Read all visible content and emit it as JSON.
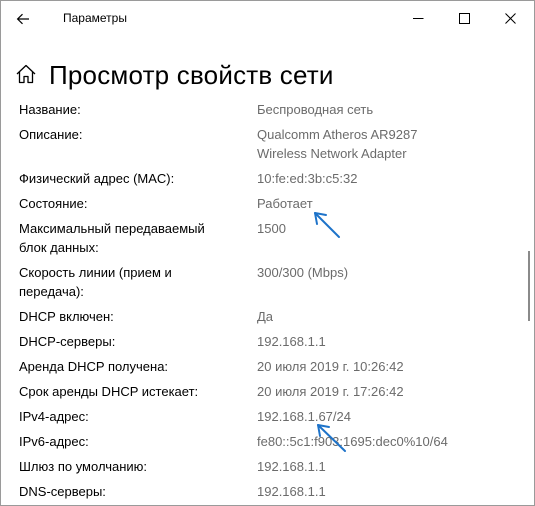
{
  "window": {
    "title": "Параметры"
  },
  "page": {
    "title": "Просмотр свойств сети"
  },
  "icons": {
    "back": "back-arrow-icon",
    "minimize": "minimize-icon",
    "maximize": "maximize-icon",
    "close": "close-icon",
    "home": "home-icon"
  },
  "colors": {
    "label": "#000000",
    "value": "#6b6b6b",
    "annotation": "#1e73c9"
  },
  "properties": [
    {
      "label": "Название:",
      "value": "Беспроводная сеть"
    },
    {
      "label": "Описание:",
      "value": "Qualcomm Atheros AR9287",
      "value2": "Wireless Network Adapter"
    },
    {
      "label": "Физический адрес (MAC):",
      "value": "10:fe:ed:3b:c5:32"
    },
    {
      "label": "Состояние:",
      "value": "Работает"
    },
    {
      "label": "Максимальный передаваемый",
      "label2": "блок данных:",
      "value": "1500"
    },
    {
      "label": "Скорость линии (прием и",
      "label2": "передача):",
      "value": "300/300 (Mbps)"
    },
    {
      "label": "DHCP включен:",
      "value": "Да"
    },
    {
      "label": "DHCP-серверы:",
      "value": "192.168.1.1"
    },
    {
      "label": "Аренда DHCP получена:",
      "value": "20 июля 2019 г. 10:26:42"
    },
    {
      "label": "Срок аренды DHCP истекает:",
      "value": "20 июля 2019 г. 17:26:42"
    },
    {
      "label": "IPv4-адрес:",
      "value": "192.168.1.67/24"
    },
    {
      "label": "IPv6-адрес:",
      "value": "fe80::5c1:f903:1695:dec0%10/64"
    },
    {
      "label": "Шлюз по умолчанию:",
      "value": "192.168.1.1"
    },
    {
      "label": "DNS-серверы:",
      "value": "192.168.1.1"
    }
  ]
}
